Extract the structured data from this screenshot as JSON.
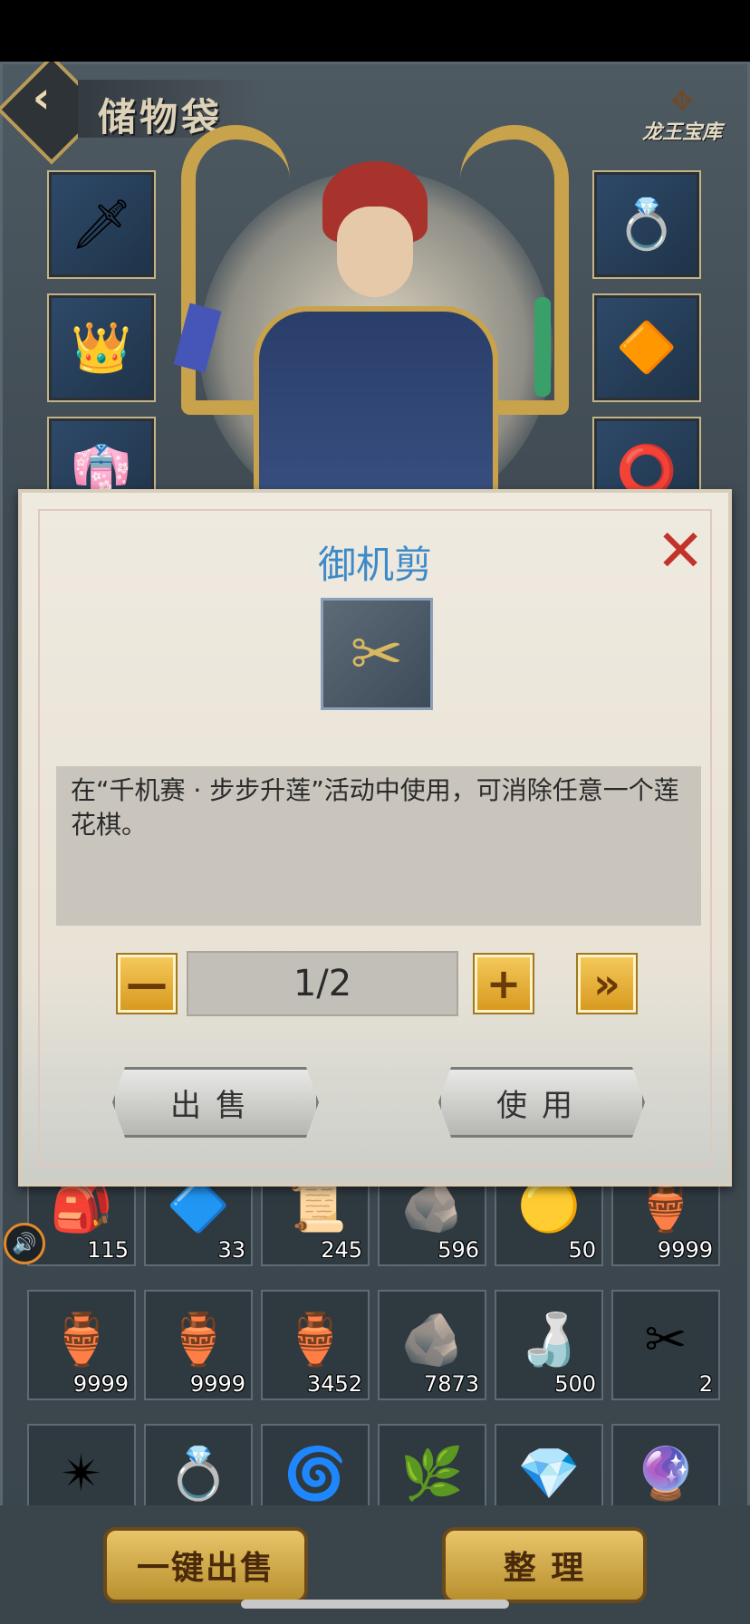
{
  "header": {
    "back_icon": "‹",
    "title": "储物袋",
    "treasure_label": "龙王宝库"
  },
  "equipment": {
    "left": [
      {
        "name": "sword",
        "icon": "🗡"
      },
      {
        "name": "helmet",
        "icon": "👑"
      },
      {
        "name": "robe",
        "icon": "👘"
      }
    ],
    "right": [
      {
        "name": "ring",
        "icon": "💍"
      },
      {
        "name": "jade-pendant",
        "icon": "🔶"
      },
      {
        "name": "bracelet",
        "icon": "⭕"
      }
    ]
  },
  "bag": {
    "row1": [
      {
        "icon": "🎒",
        "count": "115"
      },
      {
        "icon": "🔷",
        "count": "33"
      },
      {
        "icon": "📜",
        "count": "245"
      },
      {
        "icon": "🪨",
        "count": "596"
      },
      {
        "icon": "🟡",
        "count": "50"
      },
      {
        "icon": "🏺",
        "count": "9999"
      }
    ],
    "row2": [
      {
        "icon": "🏺",
        "count": "9999"
      },
      {
        "icon": "🏺",
        "count": "9999"
      },
      {
        "icon": "🏺",
        "count": "3452"
      },
      {
        "icon": "🪨",
        "count": "7873"
      },
      {
        "icon": "🍶",
        "count": "500"
      },
      {
        "icon": "✂",
        "count": "2"
      }
    ],
    "row3": [
      {
        "icon": "✴",
        "count": ""
      },
      {
        "icon": "💍",
        "count": ""
      },
      {
        "icon": "🌀",
        "count": ""
      },
      {
        "icon": "🌿",
        "count": ""
      },
      {
        "icon": "💎",
        "count": ""
      },
      {
        "icon": "🔮",
        "count": ""
      }
    ]
  },
  "bottom": {
    "sell_all_label": "一键出售",
    "sort_label": "整 理"
  },
  "modal": {
    "title": "御机剪",
    "close_icon": "✕",
    "item_icon": "✂",
    "description": "在“千机赛 · 步步升莲”活动中使用，可消除任意一个莲花棋。",
    "minus_label": "—",
    "quantity": "1/2",
    "plus_label": "+",
    "max_label": "»",
    "sell_label": "出售",
    "use_label": "使用"
  },
  "sound_icon": "🔊"
}
